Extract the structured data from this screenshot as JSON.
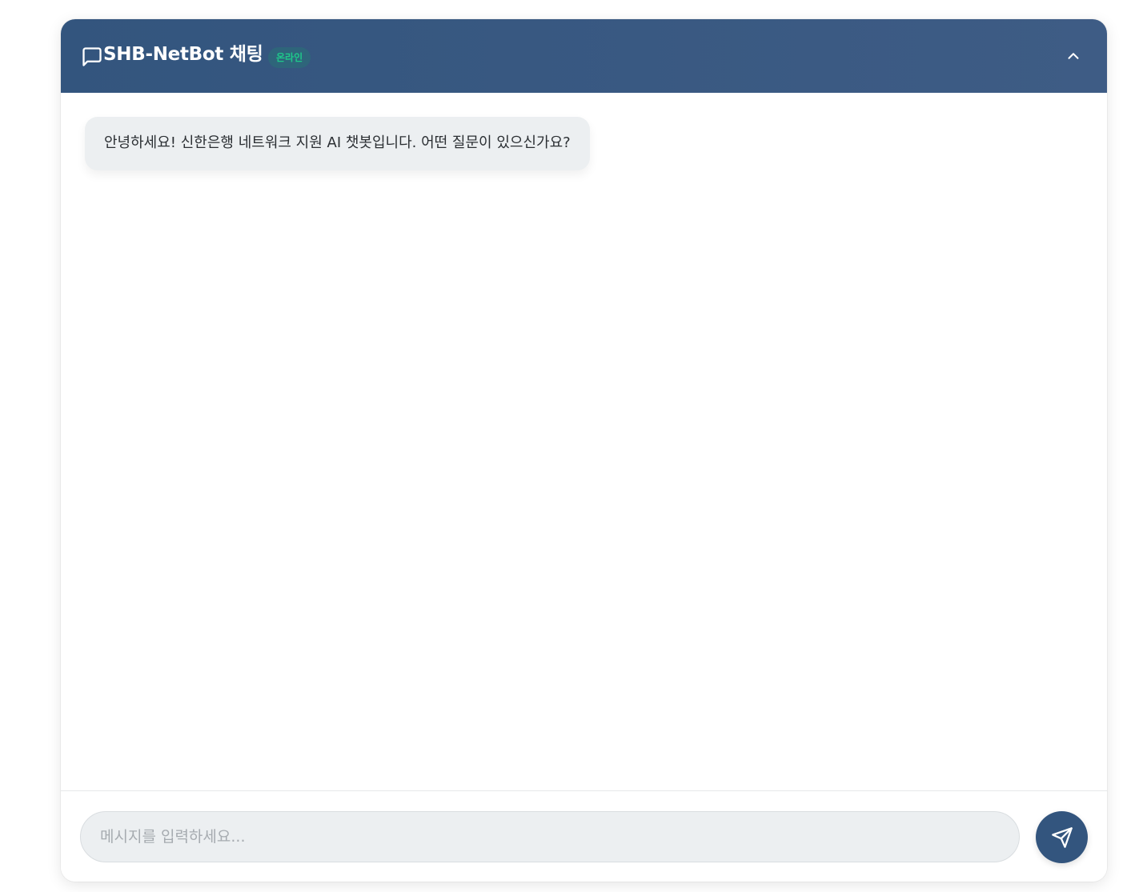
{
  "header": {
    "title": "SHB-NetBot 채팅",
    "status": "온라인",
    "chat_icon": "message-square-icon",
    "collapse_icon": "chevron-up-icon"
  },
  "messages": [
    {
      "sender": "bot",
      "text": "안녕하세요! 신한은행 네트워크 지원 AI 챗봇입니다. 어떤 질문이 있으신가요?"
    }
  ],
  "input": {
    "placeholder": "메시지를 입력하세요...",
    "value": "",
    "send_icon": "send-icon"
  },
  "colors": {
    "header_bg": "#33557e",
    "status_text": "#1ec98a",
    "bubble_bg": "#eceff1",
    "send_button_bg": "#33557e"
  }
}
